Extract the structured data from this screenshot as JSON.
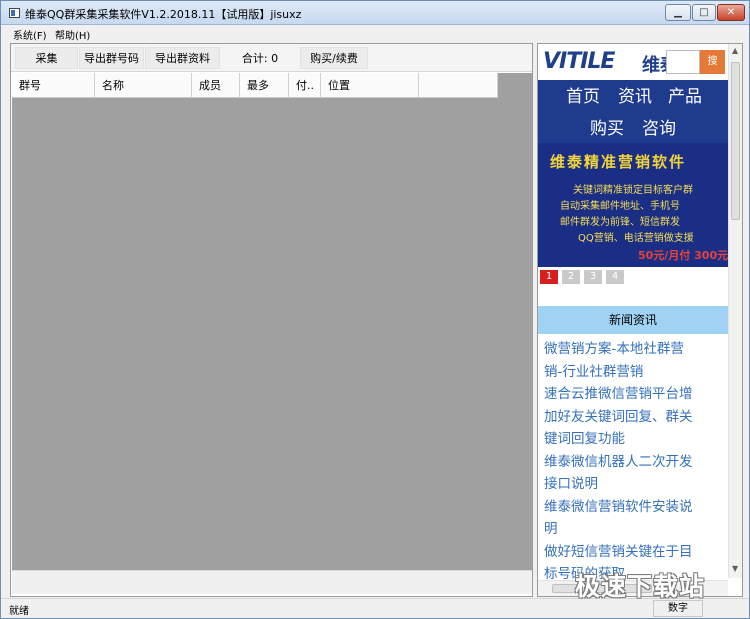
{
  "window": {
    "title": "维泰QQ群采集采集软件V1.2.2018.11【试用版】jisuxz",
    "min_label": "▁",
    "max_label": "□",
    "close_label": "✕"
  },
  "menu": {
    "system": "系统(F)",
    "help": "帮助(H)"
  },
  "toolbar": {
    "collect": "采集",
    "export_numbers": "导出群号码",
    "export_info": "导出群资料",
    "total": "合计: 0",
    "buy": "购买/续费"
  },
  "table": {
    "columns": [
      "群号",
      "名称",
      "成员",
      "最多",
      "付..",
      "位置",
      ""
    ],
    "rows": []
  },
  "ad": {
    "logo_text": "VITILE",
    "logo_cn": "维泰",
    "search_button": "搜",
    "nav": [
      "首页",
      "资讯",
      "产品",
      "购买",
      "咨询"
    ],
    "slide_title": "维泰精准营销软件",
    "slide_lines": [
      "关键词精准锁定目标客户群",
      "自动采集邮件地址、手机号",
      "邮件群发为前锋、短信群发",
      "QQ营销、电话营销做支援"
    ],
    "slide_price": "50元/月付 300元",
    "pager": [
      "1",
      "2",
      "3",
      "4"
    ],
    "news_header": "新闻资讯",
    "news_lines": [
      "微营销方案-本地社群营",
      "销-行业社群营销",
      "速合云推微信营销平台增",
      "加好友关键词回复、群关",
      "键词回复功能",
      "维泰微信机器人二次开发",
      "接口说明",
      "维泰微信营销软件安装说",
      "明",
      "做好短信营销关键在于目",
      "标号码的获取"
    ]
  },
  "status": {
    "text": "就绪",
    "numlock": "数字"
  },
  "watermark": "极速下载站",
  "colors": {
    "ad_blue": "#1f3b8d",
    "ad_yellow": "#f0d43a",
    "news_blue": "#3471b9",
    "news_header_bg": "#9fd2f3"
  }
}
